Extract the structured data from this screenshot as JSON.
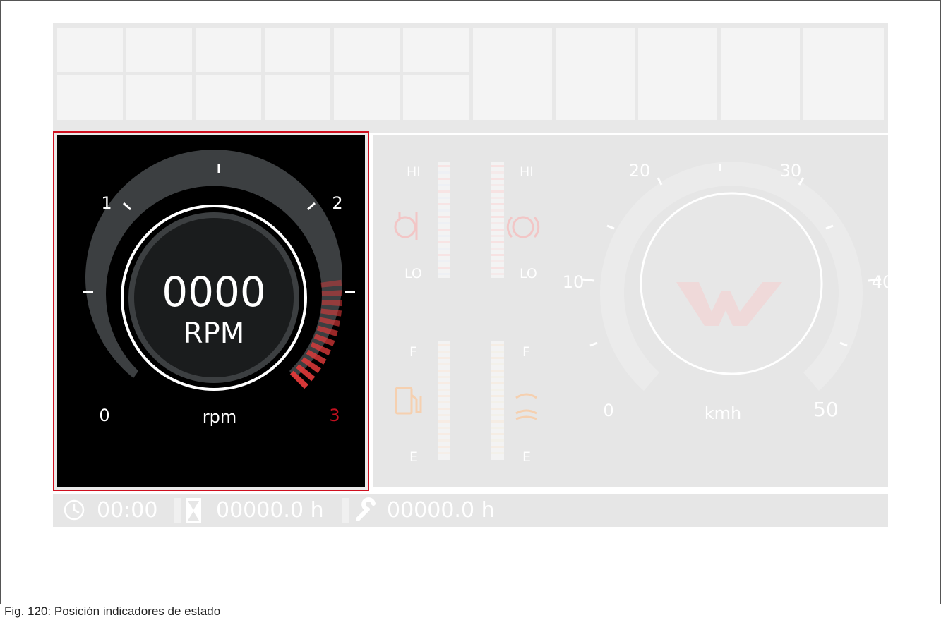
{
  "caption": "Fig. 120: Posición indicadores de estado",
  "tachometer": {
    "value": "0000",
    "unit": "RPM",
    "label": "rpm",
    "scale_labels": [
      "0",
      "1",
      "2",
      "3"
    ],
    "redline_color": "#c0101f"
  },
  "gauges": {
    "temperature_high": "HI",
    "temperature_low": "LO",
    "pressure_high": "HI",
    "pressure_low": "LO",
    "fuel_full": "F",
    "fuel_empty": "E",
    "def_full": "F",
    "def_empty": "E"
  },
  "speedometer": {
    "scale_labels": [
      "0",
      "10",
      "20",
      "30",
      "40",
      "50"
    ],
    "unit": "kmh"
  },
  "status_bar": {
    "clock": "00:00",
    "hour_meter": "00000.0 h",
    "service_meter": "00000.0 h"
  },
  "colors": {
    "highlight": "#d0101f",
    "accent_red": "#e23a3a",
    "panel_black": "#000000"
  }
}
